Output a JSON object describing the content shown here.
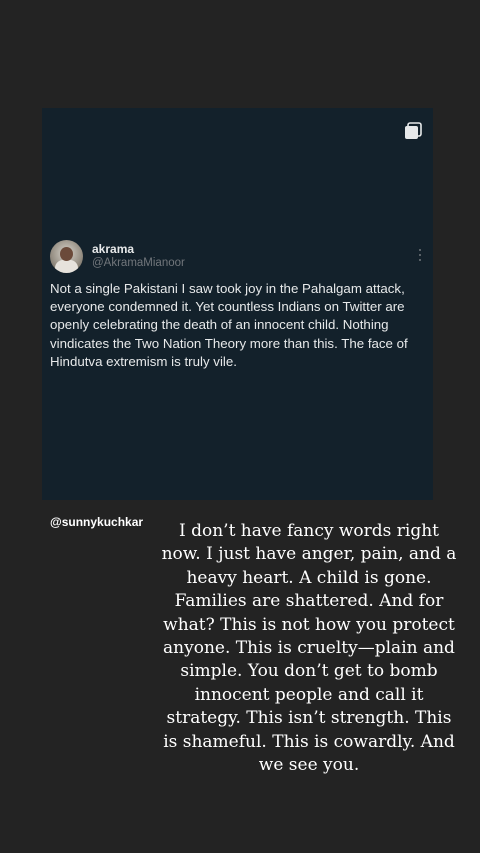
{
  "post": {
    "display_name": "akrama",
    "handle": "@AkramaMianoor",
    "text": "Not a single Pakistani I saw took joy in the Pahalgam attack, everyone condemned it. Yet countless Indians on Twitter are openly celebrating the death of an innocent child. Nothing vindicates the Two Nation Theory more than this. The face of Hindutva extremism is truly vile.",
    "icons": {
      "multi": "multiple-images-icon",
      "more": "more-options-icon",
      "avatar": "avatar"
    }
  },
  "story": {
    "mention": "@sunnykuchkar",
    "caption": "I don’t have fancy words right now. I just have anger, pain, and a heavy heart. A child is gone. Families are shattered. And for what? This is not how you protect anyone. This is cruelty—plain and simple. You don’t get to bomb innocent people and call it strategy. This isn’t strength. This is shameful. This is cowardly. And we see you."
  },
  "colors": {
    "background": "#232323",
    "card": "#13212b",
    "primary_text": "#e7e9ea",
    "secondary_text": "#71767b"
  }
}
